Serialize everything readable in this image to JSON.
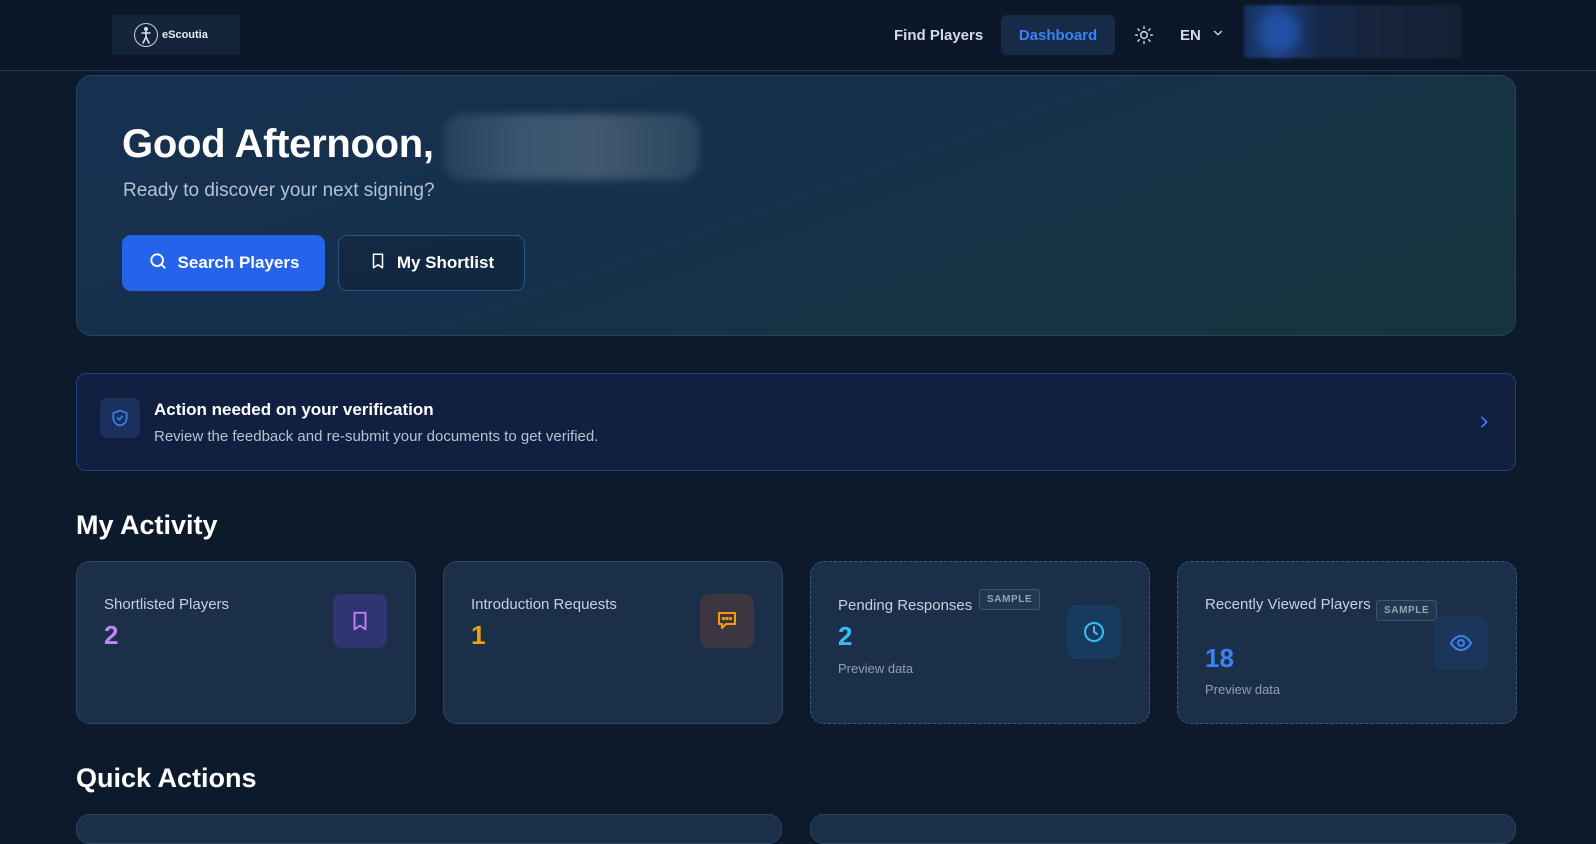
{
  "nav": {
    "logo_text": "eScoutia",
    "find_players": "Find Players",
    "dashboard": "Dashboard",
    "language": "EN"
  },
  "hero": {
    "greeting": "Good Afternoon,",
    "subtitle": "Ready to discover your next signing?",
    "search_button": "Search Players",
    "shortlist_button": "My Shortlist"
  },
  "verification": {
    "title": "Action needed on your verification",
    "description": "Review the feedback and re-submit your documents to get verified."
  },
  "activity": {
    "title": "My Activity",
    "sample_badge": "SAMPLE",
    "cards": [
      {
        "label": "Shortlisted Players",
        "value": "2",
        "color": "#c084fc",
        "icon": "bookmark-icon"
      },
      {
        "label": "Introduction Requests",
        "value": "1",
        "color": "#f59e0b",
        "icon": "message-dots-icon"
      },
      {
        "label": "Pending Responses",
        "value": "2",
        "color": "#38bdf8",
        "icon": "clock-icon",
        "preview": "Preview data"
      },
      {
        "label": "Recently Viewed Players",
        "value": "18",
        "color": "#3b82f6",
        "icon": "eye-icon",
        "preview": "Preview data"
      }
    ]
  },
  "quick_actions": {
    "title": "Quick Actions"
  },
  "colors": {
    "background": "#0d1a2c",
    "primary": "#2563eb",
    "accent_blue": "#3b82f6"
  }
}
